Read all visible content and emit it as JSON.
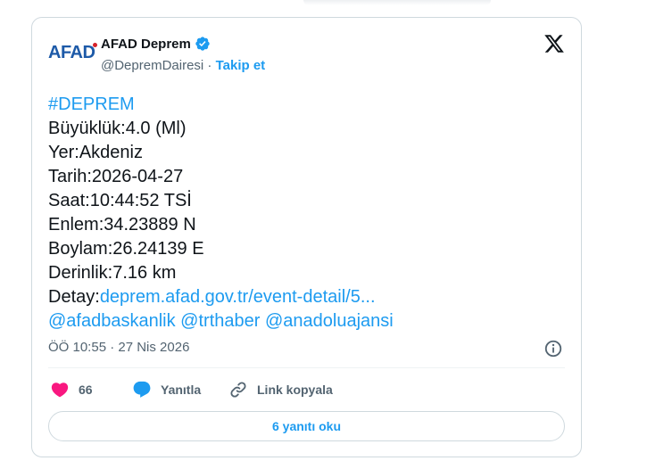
{
  "tweet": {
    "author": {
      "logo_text": "AFAD",
      "display_name": "AFAD Deprem",
      "handle": "@DepremDairesi",
      "separator": " · ",
      "follow_label": "Takip et"
    },
    "lines": {
      "hashtag": "#DEPREM",
      "magnitude": "Büyüklük:4.0 (Ml)",
      "location": "Yer:Akdeniz",
      "date": "Tarih:2026-04-27",
      "time": "Saat:10:44:52 TSİ",
      "latitude": "Enlem:34.23889 N",
      "longitude": "Boylam:26.24139 E",
      "depth": "Derinlik:7.16 km",
      "detail_label": "Detay:",
      "detail_link": "deprem.afad.gov.tr/event-detail/5...",
      "mention_1": "@afadbaskanlik",
      "mention_2": "@trthaber",
      "mention_3": "@anadoluajansi"
    },
    "timestamp": "ÖÖ 10:55 · 27 Nis 2026",
    "likes": "66",
    "reply_label": "Yanıtla",
    "copy_link_label": "Link kopyala",
    "read_replies_label": "6 yanıtı oku"
  },
  "colors": {
    "accent": "#1d9bf0",
    "like": "#f91880",
    "text": "#0f1419",
    "muted": "#536471",
    "brand_blue": "#1d5aa8",
    "brand_red": "#d6232a"
  },
  "icons": [
    "verified-badge-icon",
    "x-logo-icon",
    "info-icon",
    "heart-icon",
    "reply-bubble-icon",
    "link-icon"
  ]
}
